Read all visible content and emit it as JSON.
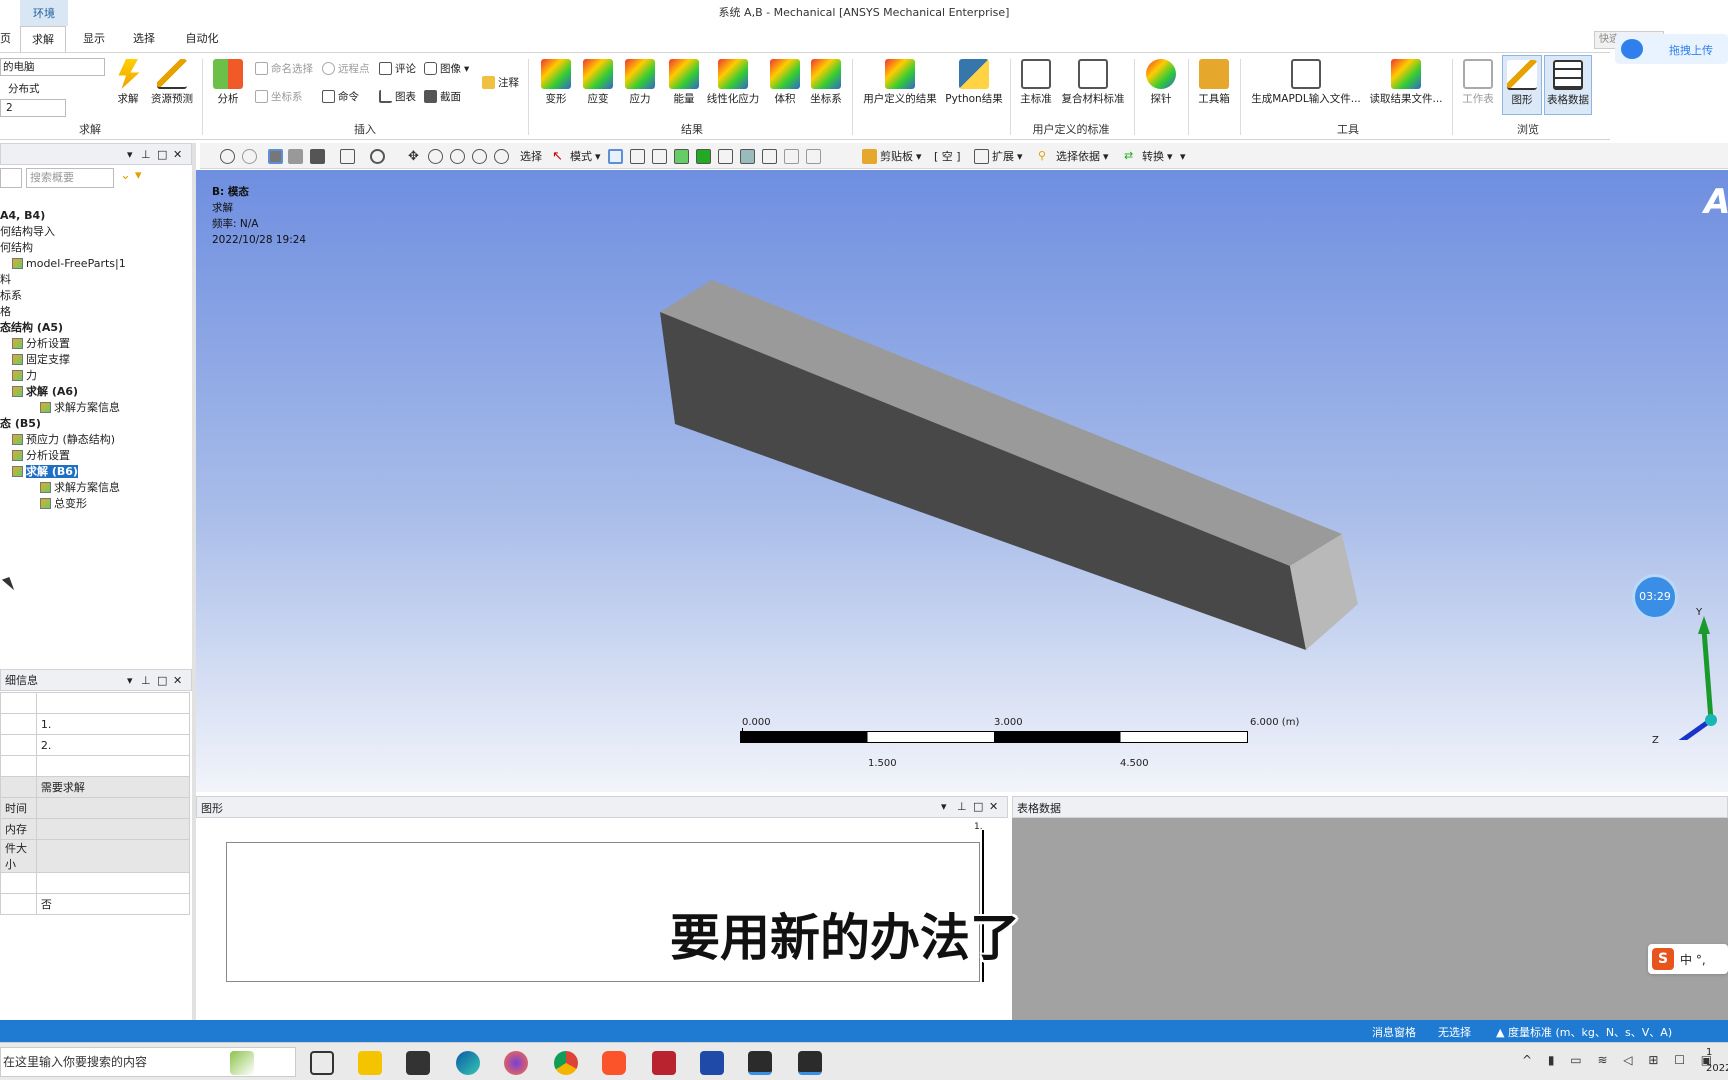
{
  "window": {
    "title": "系统 A,B - Mechanical [ANSYS Mechanical Enterprise]",
    "context_tab": "环境"
  },
  "tabs": [
    "页",
    "求解",
    "显示",
    "选择",
    "自动化"
  ],
  "ribbon": {
    "solve_group": {
      "machine": "的电脑",
      "distributed": "分布式",
      "cores": "2",
      "solve": "求解",
      "resource": "资源预测",
      "label": "求解"
    },
    "insert_group": {
      "analysis": "分析",
      "named_sel": "命名选择",
      "remote_pt": "远程点",
      "comment": "评论",
      "image": "图像",
      "note": "注释",
      "coord": "坐标系",
      "command": "命令",
      "chart": "图表",
      "section": "截面",
      "label": "插入"
    },
    "result_group": {
      "items": [
        "变形",
        "应变",
        "应力",
        "能量",
        "线性化应力",
        "体积",
        "坐标系"
      ],
      "label": "结果"
    },
    "user_group": {
      "user_result": "用户定义的结果",
      "python": "Python结果",
      "criteria": "主标准",
      "composite": "复合材料标准",
      "label": "用户定义的标准"
    },
    "tools_group": {
      "probe": "探针",
      "toolbox": "工具箱",
      "mapdl": "生成MAPDL输入文件...",
      "read": "读取结果文件...",
      "label": "工具"
    },
    "browse_group": {
      "worksheet": "工作表",
      "graph": "图形",
      "table": "表格数据",
      "label": "浏览"
    },
    "quick": "快速"
  },
  "cloud": {
    "label": "拖拽上传"
  },
  "toolbar": {
    "select": "选择",
    "mode": "模式",
    "clipboard": "剪贴板",
    "empty": "[ 空 ]",
    "extend": "扩展",
    "by": "选择依据",
    "convert": "转换"
  },
  "outline": {
    "search_placeholder": "搜索概要",
    "items": [
      {
        "text": "A4, B4)",
        "bold": true,
        "indent": 0
      },
      {
        "text": "何结构导入",
        "bold": false,
        "indent": 0
      },
      {
        "text": "何结构",
        "bold": false,
        "indent": 0
      },
      {
        "text": "model-FreeParts|1",
        "bold": false,
        "indent": 12
      },
      {
        "text": "料",
        "bold": false,
        "indent": 0
      },
      {
        "text": "标系",
        "bold": false,
        "indent": 0
      },
      {
        "text": "格",
        "bold": false,
        "indent": 0
      },
      {
        "text": "态结构 (A5)",
        "bold": true,
        "indent": 0
      },
      {
        "text": "分析设置",
        "bold": false,
        "indent": 12
      },
      {
        "text": "固定支撑",
        "bold": false,
        "indent": 12
      },
      {
        "text": "力",
        "bold": false,
        "indent": 12
      },
      {
        "text": "求解 (A6)",
        "bold": true,
        "indent": 12
      },
      {
        "text": "求解方案信息",
        "bold": false,
        "indent": 40
      },
      {
        "text": "态 (B5)",
        "bold": true,
        "indent": 0
      },
      {
        "text": "预应力 (静态结构)",
        "bold": false,
        "indent": 12
      },
      {
        "text": "分析设置",
        "bold": false,
        "indent": 12
      },
      {
        "text": "求解 (B6)",
        "bold": true,
        "indent": 12,
        "selected": true
      },
      {
        "text": "求解方案信息",
        "bold": false,
        "indent": 40
      },
      {
        "text": "总变形",
        "bold": false,
        "indent": 40
      }
    ]
  },
  "details": {
    "title": "细信息",
    "rows": [
      [
        "",
        ""
      ],
      [
        "",
        "1."
      ],
      [
        "",
        "2."
      ],
      [
        "",
        ""
      ],
      [
        "",
        "需要求解"
      ],
      [
        "时间",
        ""
      ],
      [
        "内存",
        ""
      ],
      [
        "件大小",
        ""
      ],
      [
        "",
        ""
      ],
      [
        "",
        "否"
      ]
    ]
  },
  "viewport": {
    "name": "B: 模态",
    "type": "求解",
    "freq": "频率: N/A",
    "date": "2022/10/28 19:24",
    "logo": "A"
  },
  "scale": {
    "t0": "0.000",
    "t3": "3.000",
    "t6": "6.000 (m)",
    "t15": "1.500",
    "t45": "4.500"
  },
  "timer": "03:29",
  "axes": {
    "y": "Y",
    "z": "Z"
  },
  "graph_panel": {
    "title": "图形",
    "tick": "1."
  },
  "table_panel": {
    "title": "表格数据"
  },
  "subtitle": "要用新的办法了",
  "ime": {
    "text": "中 °,"
  },
  "status": {
    "msg": "消息窗格",
    "sel": "无选择",
    "units": "度量标准 (m、kg、N、s、V、A)"
  },
  "taskbar": {
    "search": "在这里输入你要搜索的内容",
    "clock": "1",
    "year": "2022"
  }
}
